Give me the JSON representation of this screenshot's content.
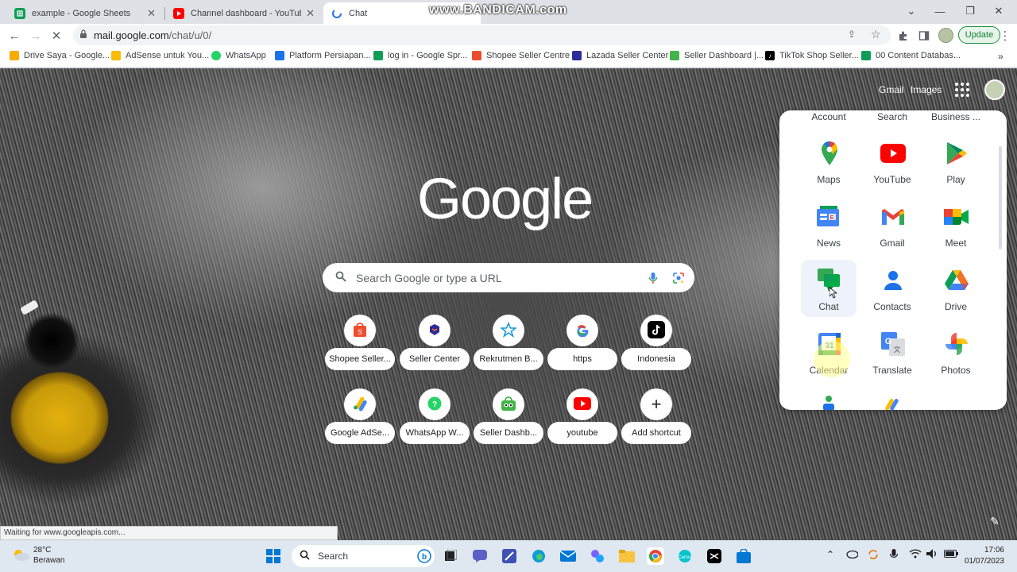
{
  "browser": {
    "tabs": [
      {
        "title": "example - Google Sheets",
        "icon": "sheets-icon",
        "active": false
      },
      {
        "title": "Channel dashboard - YouTube St",
        "icon": "youtube-icon",
        "active": false
      },
      {
        "title": "Chat",
        "icon": "chat-icon",
        "active": true
      }
    ],
    "watermark": "www.BANDICAM.com",
    "address": {
      "host": "mail.google.com",
      "path": "/chat/u/0/"
    },
    "update_label": "Update",
    "bookmarks": [
      {
        "label": "Drive Saya - Google...",
        "icon": "drive-icon",
        "color": "#f9ab00"
      },
      {
        "label": "AdSense untuk You...",
        "icon": "adsense-icon",
        "color": "#fbbc04"
      },
      {
        "label": "WhatsApp",
        "icon": "whatsapp-icon",
        "color": "#25d366"
      },
      {
        "label": "Platform Persiapan...",
        "icon": "platform-icon",
        "color": "#1a73e8"
      },
      {
        "label": "log in - Google Spr...",
        "icon": "sheets-icon",
        "color": "#0f9d58"
      },
      {
        "label": "Shopee Seller Centre",
        "icon": "shopee-icon",
        "color": "#ee4d2d"
      },
      {
        "label": "Lazada Seller Center",
        "icon": "lazada-icon",
        "color": "#2d2a9b"
      },
      {
        "label": "Seller Dashboard |...",
        "icon": "tokopedia-icon",
        "color": "#42b549"
      },
      {
        "label": "TikTok Shop Seller...",
        "icon": "tiktok-icon",
        "color": "#000000"
      },
      {
        "label": "00 Content Databas...",
        "icon": "sheets-icon",
        "color": "#0f9d58"
      }
    ]
  },
  "newtab": {
    "top_links": {
      "gmail": "Gmail",
      "images": "Images"
    },
    "logo_text": "Google",
    "search_placeholder": "Search Google or type a URL",
    "shortcuts": [
      {
        "label": "Shopee Seller...",
        "icon": "shopee-icon"
      },
      {
        "label": "Seller Center",
        "icon": "lazada-icon"
      },
      {
        "label": "Rekrutmen B...",
        "icon": "rekrutmen-icon"
      },
      {
        "label": "https",
        "icon": "google-g-icon"
      },
      {
        "label": "Indonesia",
        "icon": "tiktok-icon"
      },
      {
        "label": "Google AdSe...",
        "icon": "adsense-icon"
      },
      {
        "label": "WhatsApp W...",
        "icon": "whatsapp-icon"
      },
      {
        "label": "Seller Dashb...",
        "icon": "tokopedia-icon"
      },
      {
        "label": "youtube",
        "icon": "youtube-icon"
      },
      {
        "label": "Add shortcut",
        "icon": "plus-icon"
      }
    ],
    "status_text": "Waiting for www.googleapis.com..."
  },
  "apps_panel": {
    "top_row": [
      "Account",
      "Search",
      "Business ..."
    ],
    "apps": [
      {
        "label": "Maps",
        "icon": "maps-icon"
      },
      {
        "label": "YouTube",
        "icon": "youtube-icon"
      },
      {
        "label": "Play",
        "icon": "play-icon"
      },
      {
        "label": "News",
        "icon": "news-icon"
      },
      {
        "label": "Gmail",
        "icon": "gmail-icon"
      },
      {
        "label": "Meet",
        "icon": "meet-icon"
      },
      {
        "label": "Chat",
        "icon": "chat-icon",
        "hovered": true
      },
      {
        "label": "Contacts",
        "icon": "contacts-icon"
      },
      {
        "label": "Drive",
        "icon": "drive-icon"
      },
      {
        "label": "Calendar",
        "icon": "calendar-icon"
      },
      {
        "label": "Translate",
        "icon": "translate-icon"
      },
      {
        "label": "Photos",
        "icon": "photos-icon"
      }
    ]
  },
  "taskbar": {
    "weather": {
      "temp": "28°C",
      "condition": "Berawan"
    },
    "search_label": "Search",
    "time": "17:06",
    "date": "01/07/2023"
  }
}
